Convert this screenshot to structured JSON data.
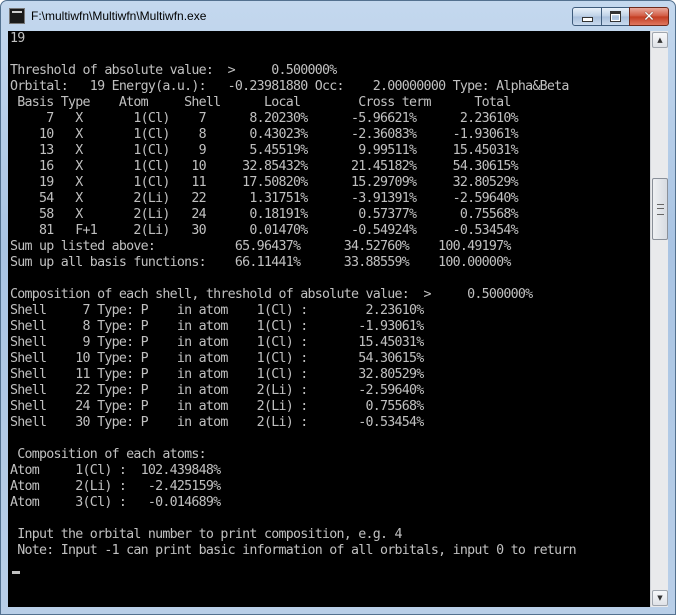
{
  "window": {
    "title": "F:\\multiwfn\\Multiwfn\\Multiwfn.exe",
    "icon": "console-app-icon"
  },
  "controls": {
    "minimize": "minimize-icon",
    "maximize": "maximize-icon",
    "close_glyph": "✕"
  },
  "scrollbar": {
    "up_glyph": "▲",
    "down_glyph": "▼"
  },
  "console": {
    "lines": [
      "19",
      "",
      "Threshold of absolute value:  >     0.500000%",
      "Orbital:   19 Energy(a.u.):   -0.23981880 Occ:    2.00000000 Type: Alpha&Beta",
      " Basis Type    Atom     Shell      Local        Cross term      Total",
      "     7   X       1(Cl)    7      8.20230%      -5.96621%      2.23610%",
      "    10   X       1(Cl)    8      0.43023%      -2.36083%     -1.93061%",
      "    13   X       1(Cl)    9      5.45519%       9.99511%     15.45031%",
      "    16   X       1(Cl)   10     32.85432%      21.45182%     54.30615%",
      "    19   X       1(Cl)   11     17.50820%      15.29709%     32.80529%",
      "    54   X       2(Li)   22      1.31751%      -3.91391%     -2.59640%",
      "    58   X       2(Li)   24      0.18191%       0.57377%      0.75568%",
      "    81   F+1     2(Li)   30      0.01470%      -0.54924%     -0.53454%",
      "Sum up listed above:           65.96437%      34.52760%    100.49197%",
      "Sum up all basis functions:    66.11441%      33.88559%    100.00000%",
      "",
      "Composition of each shell, threshold of absolute value:  >     0.500000%",
      "Shell     7 Type: P    in atom    1(Cl) :        2.23610%",
      "Shell     8 Type: P    in atom    1(Cl) :       -1.93061%",
      "Shell     9 Type: P    in atom    1(Cl) :       15.45031%",
      "Shell    10 Type: P    in atom    1(Cl) :       54.30615%",
      "Shell    11 Type: P    in atom    1(Cl) :       32.80529%",
      "Shell    22 Type: P    in atom    2(Li) :       -2.59640%",
      "Shell    24 Type: P    in atom    2(Li) :        0.75568%",
      "Shell    30 Type: P    in atom    2(Li) :       -0.53454%",
      "",
      " Composition of each atoms:",
      "Atom     1(Cl) :  102.439848%",
      "Atom     2(Li) :   -2.425159%",
      "Atom     3(Cl) :   -0.014689%",
      "",
      " Input the orbital number to print composition, e.g. 4",
      " Note: Input -1 can print basic information of all orbitals, input 0 to return"
    ]
  }
}
